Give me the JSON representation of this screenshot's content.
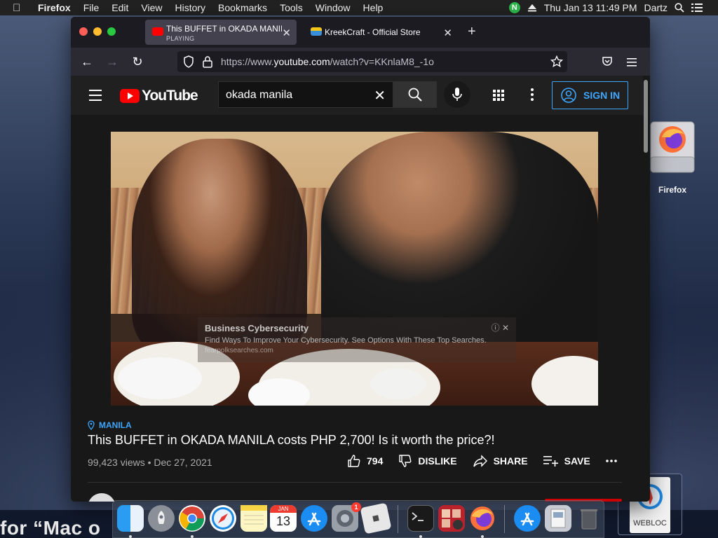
{
  "menubar": {
    "app": "Firefox",
    "items": [
      "File",
      "Edit",
      "View",
      "History",
      "Bookmarks",
      "Tools",
      "Window",
      "Help"
    ],
    "status_badge": "N",
    "datetime": "Thu Jan 13  11:49 PM",
    "user": "Dartz"
  },
  "desktop": {
    "icon_label": "Firefox",
    "webloc_label": "WEBLOC",
    "partial_text": "for “Mac o"
  },
  "browser": {
    "tabs": [
      {
        "title": "This BUFFET in OKADA MANILA",
        "subtitle": "PLAYING"
      },
      {
        "title": "KreekCraft - Official Store"
      }
    ],
    "url_prefix": "https://www.",
    "url_domain": "youtube.com",
    "url_suffix": "/watch?v=KKnlaM8_-1o"
  },
  "youtube": {
    "logo_text": "YouTube",
    "search_value": "okada manila",
    "signin_label": "SIGN IN",
    "ad": {
      "title": "Business Cybersecurity",
      "text": "Find Ways To Improve Your Cybersecurity. See Options With These Top Searches.",
      "url": "fearpolksearches.com"
    },
    "location": "MANILA",
    "title": "This BUFFET in OKADA MANILA costs PHP 2,700! Is it worth the price?!",
    "meta": "99,423 views • Dec 27, 2021",
    "actions": {
      "likes": "794",
      "dislike": "DISLIKE",
      "share": "SHARE",
      "save": "SAVE"
    }
  },
  "dock": {
    "calendar_month": "JAN",
    "calendar_day": "13",
    "settings_badge": "1"
  },
  "colors": {
    "accent_blue": "#3ea6ff",
    "youtube_red": "#ff0000",
    "page_bg": "#181818"
  }
}
